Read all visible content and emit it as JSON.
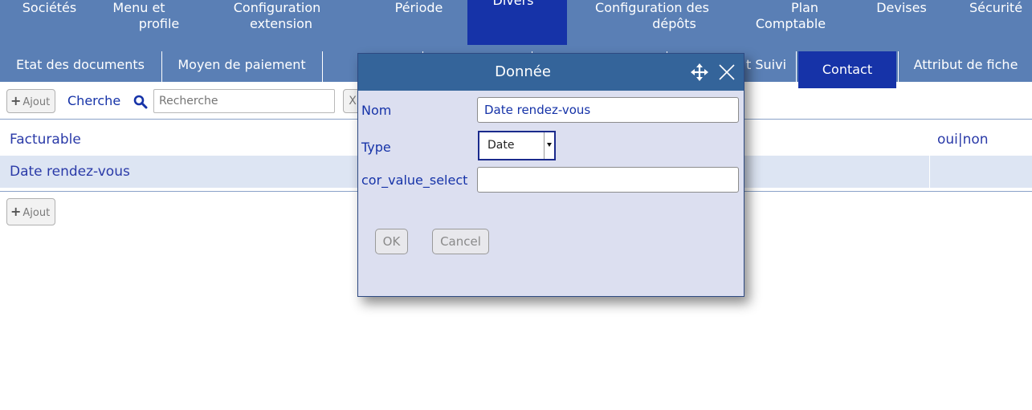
{
  "top_menu": [
    {
      "label_1": "Sociétés",
      "label_2": ""
    },
    {
      "label_1": "Menu et",
      "label_2": "profile"
    },
    {
      "label_1": "Configuration",
      "label_2": "extension"
    },
    {
      "label_1": "Période",
      "label_2": ""
    },
    {
      "label_1": "Divers",
      "label_2": ""
    },
    {
      "label_1": "Configuration des",
      "label_2": "dépôts"
    },
    {
      "label_1": "Plan",
      "label_2": "Comptable"
    },
    {
      "label_1": "Devises",
      "label_2": ""
    },
    {
      "label_1": "Sécurité",
      "label_2": ""
    }
  ],
  "sub_menu": {
    "etat_documents": "Etat des documents",
    "moyen_paiement": "Moyen de paiement",
    "suivi_partial": "t Suivi",
    "contact": "Contact",
    "attribut_fiche": "Attribut de fiche"
  },
  "toolbar": {
    "add_label": "Ajout",
    "search_label": "Cherche",
    "search_placeholder": "Recherche",
    "clear_label": "X"
  },
  "table": {
    "rows": [
      {
        "name": "Facturable",
        "value": "oui|non"
      },
      {
        "name": "Date rendez-vous",
        "value": ""
      }
    ]
  },
  "bottom_add_label": "Ajout",
  "dialog": {
    "title": "Donnée",
    "fields": {
      "nom_label": "Nom",
      "nom_value": "Date rendez-vous",
      "type_label": "Type",
      "type_value": "Date",
      "cor_label": "cor_value_select",
      "cor_value": ""
    },
    "ok_label": "OK",
    "cancel_label": "Cancel"
  },
  "colors": {
    "menu_bg": "#5a7fb5",
    "menu_active": "#1633a8",
    "dialog_header": "#34649a",
    "dialog_body": "#dcdff0",
    "row_highlight": "#dde5f3"
  }
}
